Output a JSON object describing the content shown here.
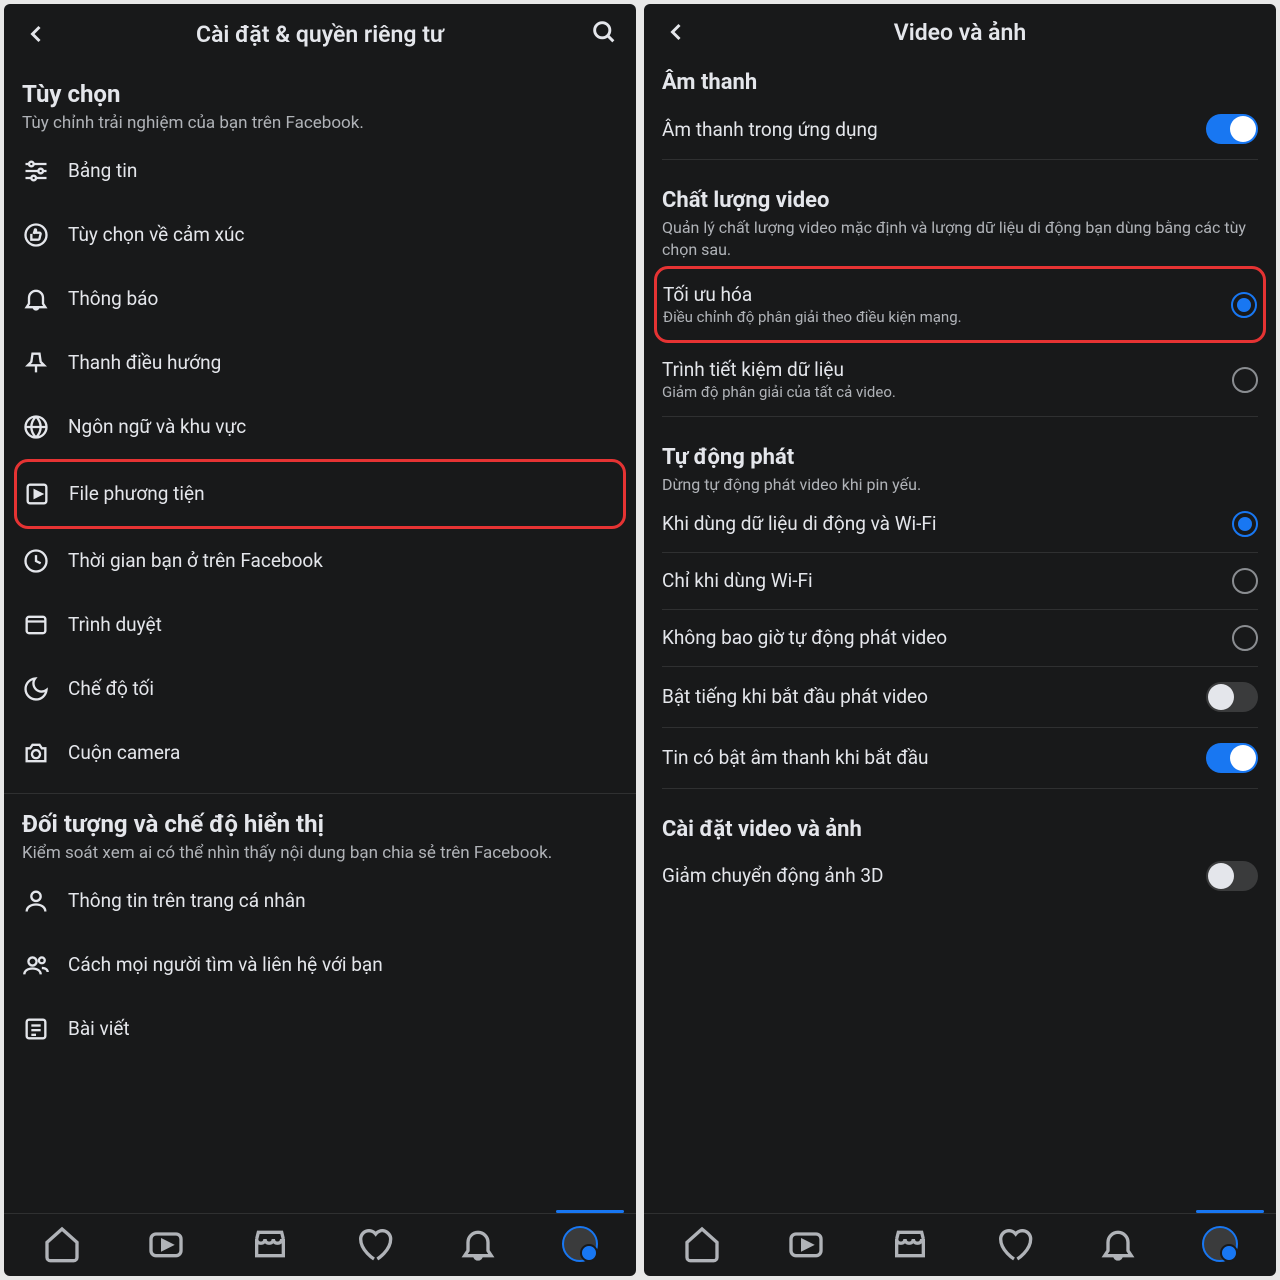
{
  "left": {
    "header_title": "Cài đặt & quyền riêng tư",
    "preferences": {
      "title": "Tùy chọn",
      "sub": "Tùy chỉnh trải nghiệm của bạn trên Facebook.",
      "items": [
        {
          "label": "Bảng tin"
        },
        {
          "label": "Tùy chọn về cảm xúc"
        },
        {
          "label": "Thông báo"
        },
        {
          "label": "Thanh điều hướng"
        },
        {
          "label": "Ngôn ngữ và khu vực"
        },
        {
          "label": "File phương tiện"
        },
        {
          "label": "Thời gian bạn ở trên Facebook"
        },
        {
          "label": "Trình duyệt"
        },
        {
          "label": "Chế độ tối"
        },
        {
          "label": "Cuộn camera"
        }
      ]
    },
    "audience": {
      "title": "Đối tượng và chế độ hiển thị",
      "sub": "Kiểm soát xem ai có thể nhìn thấy nội dung bạn chia sẻ trên Facebook.",
      "items": [
        {
          "label": "Thông tin trên trang cá nhân"
        },
        {
          "label": "Cách mọi người tìm và liên hệ với bạn"
        },
        {
          "label": "Bài viết"
        }
      ]
    }
  },
  "right": {
    "header_title": "Video và ảnh",
    "sound": {
      "title": "Âm thanh",
      "row_label": "Âm thanh trong ứng dụng"
    },
    "quality": {
      "title": "Chất lượng video",
      "sub": "Quản lý chất lượng video mặc định và lượng dữ liệu di động bạn dùng bằng các tùy chọn sau.",
      "opt1_label": "Tối ưu hóa",
      "opt1_desc": "Điều chỉnh độ phân giải theo điều kiện mạng.",
      "opt2_label": "Trình tiết kiệm dữ liệu",
      "opt2_desc": "Giảm độ phân giải của tất cả video."
    },
    "autoplay": {
      "title": "Tự động phát",
      "sub": "Dừng tự động phát video khi pin yếu.",
      "opt1": "Khi dùng dữ liệu di động và Wi-Fi",
      "opt2": "Chỉ khi dùng Wi-Fi",
      "opt3": "Không bao giờ tự động phát video",
      "toggle1": "Bật tiếng khi bắt đầu phát video",
      "toggle2": "Tin có bật âm thanh khi bắt đầu"
    },
    "video_photo": {
      "title": "Cài đặt video và ảnh",
      "row1": "Giảm chuyển động ảnh 3D"
    }
  }
}
